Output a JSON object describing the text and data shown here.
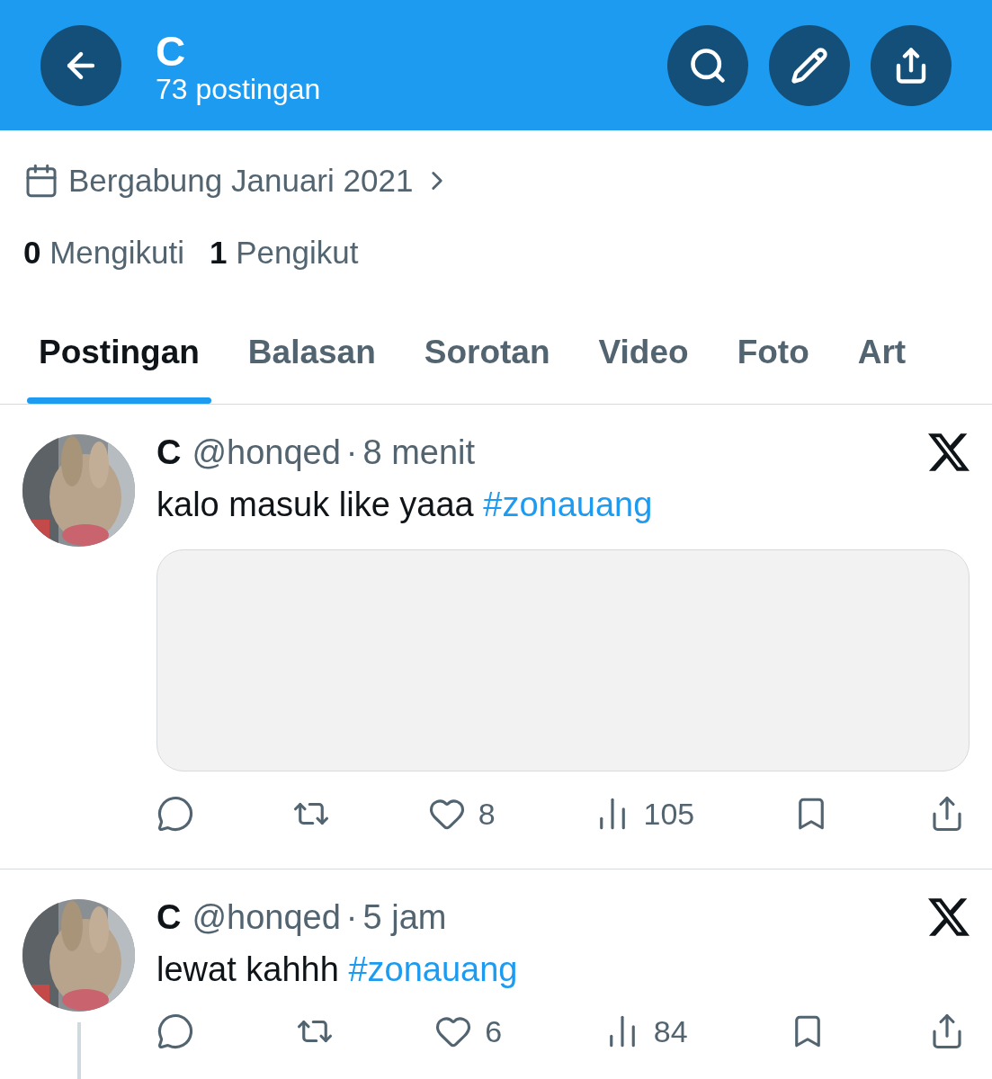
{
  "header": {
    "title": "C",
    "subtitle": "73 postingan"
  },
  "profile": {
    "joined": "Bergabung Januari 2021",
    "following_count": "0",
    "following_label": "Mengikuti",
    "followers_count": "1",
    "followers_label": "Pengikut"
  },
  "tabs": [
    {
      "label": "Postingan",
      "selected": true
    },
    {
      "label": "Balasan",
      "selected": false
    },
    {
      "label": "Sorotan",
      "selected": false
    },
    {
      "label": "Video",
      "selected": false
    },
    {
      "label": "Foto",
      "selected": false
    },
    {
      "label": "Art",
      "selected": false
    }
  ],
  "posts": [
    {
      "name": "C",
      "handle": "@honqed",
      "separator": "·",
      "time": "8 menit",
      "text": "kalo masuk like yaaa",
      "hashtag": "#zonauang",
      "media": true,
      "thread": false,
      "actions": [
        {
          "kind": "reply"
        },
        {
          "kind": "repost"
        },
        {
          "kind": "like",
          "count": "8"
        },
        {
          "kind": "views",
          "count": "105"
        },
        {
          "kind": "bookmark"
        },
        {
          "kind": "share"
        }
      ]
    },
    {
      "name": "C",
      "handle": "@honqed",
      "separator": "·",
      "time": "5 jam",
      "text": "lewat kahhh",
      "hashtag": "#zonauang",
      "media": false,
      "thread": true,
      "actions": [
        {
          "kind": "reply"
        },
        {
          "kind": "repost"
        },
        {
          "kind": "like",
          "count": "6"
        },
        {
          "kind": "views",
          "count": "84"
        },
        {
          "kind": "bookmark"
        },
        {
          "kind": "share"
        }
      ]
    }
  ]
}
